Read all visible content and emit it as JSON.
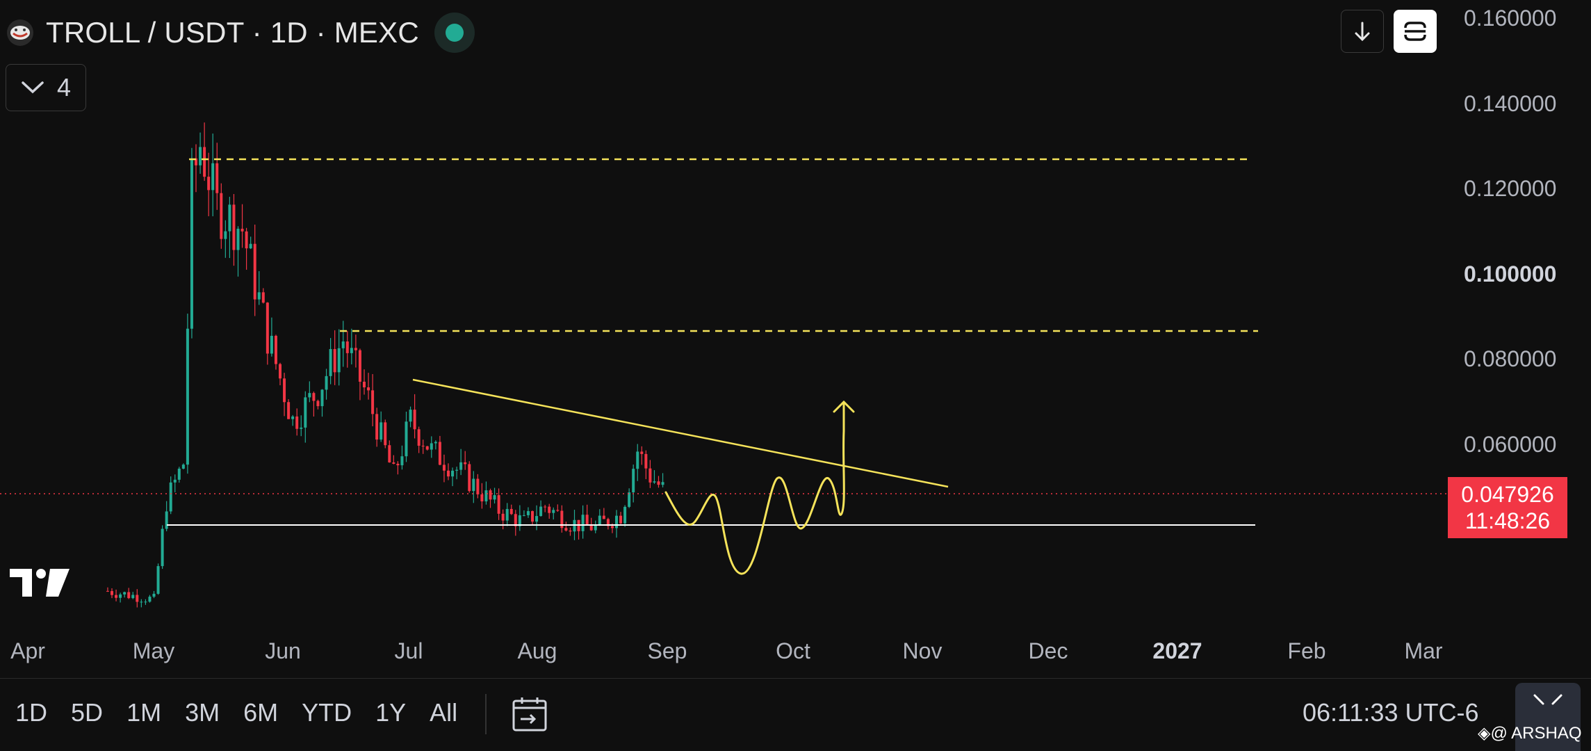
{
  "header": {
    "title": "TROLL / USDT · 1D · MEXC",
    "indicators_count": "4"
  },
  "colors": {
    "background": "#0f0f0f",
    "candle_up": "#22ab94",
    "candle_down": "#f23645",
    "drawing_yellow": "#f5e35a",
    "support_line": "#ffffff",
    "price_tag": "#f23645"
  },
  "icons": {
    "symbol": "troll-face-icon",
    "status": "market-open-dot-icon",
    "collapse": "chevron-down-icon",
    "download": "arrow-down-icon",
    "snapshot": "screenshot-icon",
    "logo": "tradingview-logo-icon",
    "date_range": "calendar-range-icon",
    "fullscreen": "fullscreen-icon"
  },
  "price_axis": {
    "labels": [
      "0.160000",
      "0.140000",
      "0.120000",
      "0.100000",
      "0.080000",
      "0.060000"
    ],
    "bold_label": "0.100000"
  },
  "current_price": {
    "value": "0.047926",
    "countdown": "11:48:26"
  },
  "time_axis": {
    "labels": [
      "Apr",
      "May",
      "Jun",
      "Jul",
      "Aug",
      "Sep",
      "Oct",
      "Nov",
      "Dec",
      "2027",
      "Feb",
      "Mar"
    ],
    "bold_label": "2027"
  },
  "footer": {
    "ranges": [
      "1D",
      "5D",
      "1M",
      "3M",
      "6M",
      "YTD",
      "1Y",
      "All"
    ],
    "clock": "06:11:33 UTC-6",
    "credit": "◈@ ARSHAQ"
  },
  "chart_data": {
    "type": "candlestick",
    "symbol": "TROLL / USDT",
    "interval": "1D",
    "exchange": "MEXC",
    "ylim": [
      0.02,
      0.16
    ],
    "x_range": [
      "2026-04-01",
      "2027-03-31"
    ],
    "current_price": 0.047926,
    "closes_approx": [
      {
        "date": "2026-04-20",
        "value": 0.025
      },
      {
        "date": "2026-05-01",
        "value": 0.023
      },
      {
        "date": "2026-05-04",
        "value": 0.046
      },
      {
        "date": "2026-05-08",
        "value": 0.055
      },
      {
        "date": "2026-05-10",
        "value": 0.12
      },
      {
        "date": "2026-05-12",
        "value": 0.13
      },
      {
        "date": "2026-05-16",
        "value": 0.115
      },
      {
        "date": "2026-05-22",
        "value": 0.11
      },
      {
        "date": "2026-05-28",
        "value": 0.085
      },
      {
        "date": "2026-06-03",
        "value": 0.065
      },
      {
        "date": "2026-06-09",
        "value": 0.072
      },
      {
        "date": "2026-06-15",
        "value": 0.084
      },
      {
        "date": "2026-06-21",
        "value": 0.07
      },
      {
        "date": "2026-06-27",
        "value": 0.052
      },
      {
        "date": "2026-07-01",
        "value": 0.065
      },
      {
        "date": "2026-07-06",
        "value": 0.058
      },
      {
        "date": "2026-07-14",
        "value": 0.052
      },
      {
        "date": "2026-07-22",
        "value": 0.044
      },
      {
        "date": "2026-07-28",
        "value": 0.041
      },
      {
        "date": "2026-08-02",
        "value": 0.045
      },
      {
        "date": "2026-08-08",
        "value": 0.041
      },
      {
        "date": "2026-08-14",
        "value": 0.04
      },
      {
        "date": "2026-08-20",
        "value": 0.043
      },
      {
        "date": "2026-08-24",
        "value": 0.058
      },
      {
        "date": "2026-08-27",
        "value": 0.052
      },
      {
        "date": "2026-08-31",
        "value": 0.0479
      }
    ],
    "drawings": {
      "resistance_1": 0.1265,
      "resistance_2": 0.0865,
      "support": 0.0417,
      "descending_trendline": [
        {
          "date": "2026-07-05",
          "value": 0.0743
        },
        {
          "date": "2026-11-06",
          "value": 0.0485
        }
      ],
      "projected_path_end": 0.068
    }
  }
}
